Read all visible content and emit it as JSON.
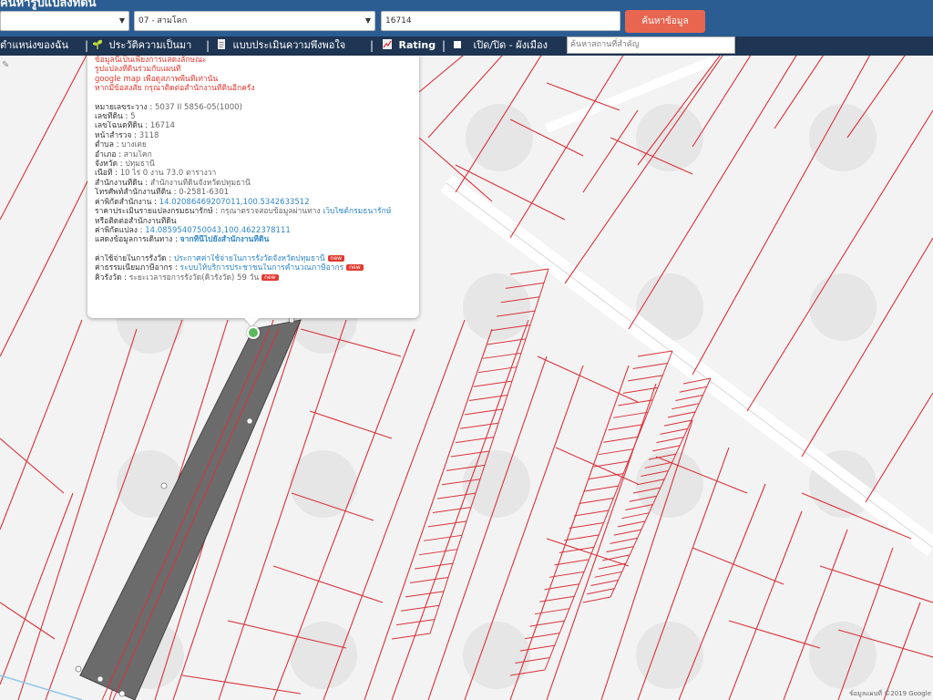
{
  "header": {
    "title": "ค้นหารูปแปลงที่ดิน",
    "province_select": "",
    "district_select": "07 - สามโคก",
    "parcel_input": "16714",
    "search_button": "ค้นหาข้อมูล"
  },
  "nav": {
    "items": [
      {
        "label": "ตำแหน่งของฉัน"
      },
      {
        "label": "ประวัติความเป็นมา"
      },
      {
        "label": "แบบประเมินความพึงพอใจ"
      },
      {
        "label": "Rating"
      },
      {
        "label": "เปิด/ปิด - ผังเมือง"
      }
    ],
    "place_placeholder": "ค้นหาสถานที่สำคัญ"
  },
  "popup": {
    "notes": [
      "ข้อมูลนี้เป็นเพียงการแสดงลักษณะ",
      "รูปแปลงที่ดินร่วมกับแผนที่",
      "google map เพื่อดูสภาพพื้นที่เท่านั้น",
      "หากมีข้อสงสัย กรุณาติดต่อสำนักงานที่ดินอีกครั้ง"
    ],
    "fields": [
      {
        "label": "หมายเลขระวาง",
        "value": "5037 II 5856-05(1000)"
      },
      {
        "label": "เลขที่ดิน",
        "value": "5"
      },
      {
        "label": "เลขโฉนดที่ดิน",
        "value": "16714"
      },
      {
        "label": "หน้าสำรวจ",
        "value": "3118"
      },
      {
        "label": "ตำบล",
        "value": "บางเตย"
      },
      {
        "label": "อำเภอ",
        "value": "สามโคก"
      },
      {
        "label": "จังหวัด",
        "value": "ปทุมธานี"
      },
      {
        "label": "เนื้อที่",
        "value": "10 ไร่ 0 งาน 73.0 ตารางวา"
      },
      {
        "label": "สำนักงานที่ดิน",
        "value": "สำนักงานที่ดินจังหวัดปทุมธานี"
      },
      {
        "label": "โทรศัพท์สำนักงานที่ดิน",
        "value": "0-2581-6301"
      },
      {
        "label": "ค่าพิกัดสำนักงาน",
        "value": "14.02086469207011,100.5342633512"
      }
    ],
    "price_label": "ราคาประเมินรายแปลงกรมธนารักษ์",
    "price_value": "กรุณาตรวจสอบข้อมูลผ่านทาง",
    "price_link": "เว็บไซต์กรมธนารักษ์",
    "price_note": "หรือติดต่อสำนักงานที่ดิน",
    "parcel_coord_label": "ค่าพิกัดแปลง",
    "parcel_coord_value": "14.0859540750043,100.4622378111",
    "route_label": "แสดงข้อมูลการเดินทาง",
    "route_link": "จากที่นี่ไปยังสำนักงานที่ดิน",
    "services": [
      {
        "label": "ค่าใช้จ่ายในการรังวัด",
        "link": "ประกาศค่าใช้จ่ายในการรังวัดจังหวัดปทุมธานี",
        "badge": "new"
      },
      {
        "label": "ค่าธรรมเนียมภาษีอากร",
        "link": "ระบบให้บริการประชาชนในการคำนวณภาษีอากร",
        "badge": "new"
      },
      {
        "label": "คิวรังวัด",
        "link": "ระยะเวลารอการรังวัด(คิวรังวัด) 59 วัน",
        "badge": "new"
      }
    ]
  },
  "map": {
    "attribution": "ข้อมูลแผนที่ ©2019 Google",
    "parcel_fill": "#6b6b6b",
    "line_color": "#d9323a"
  }
}
